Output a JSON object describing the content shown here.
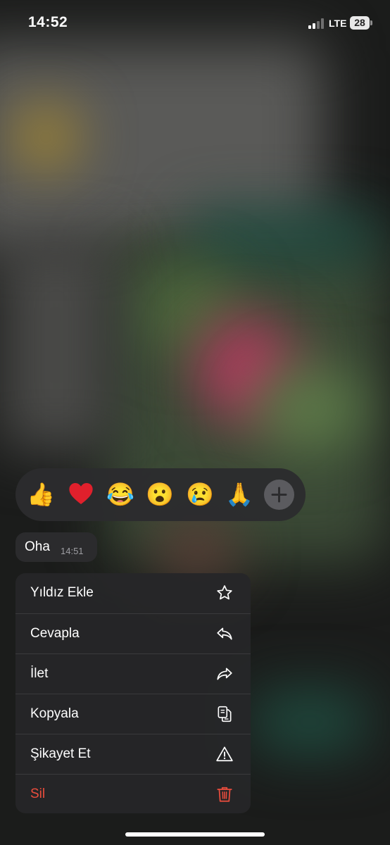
{
  "status_bar": {
    "time": "14:52",
    "network": "LTE",
    "battery": "28"
  },
  "reactions": {
    "emojis": [
      "👍",
      "❤️",
      "😂",
      "😮",
      "😢",
      "🙏"
    ],
    "more_icon": "plus-icon"
  },
  "message": {
    "text": "Oha",
    "time": "14:51"
  },
  "context_menu": {
    "items": [
      {
        "label": "Yıldız Ekle",
        "icon": "star-icon"
      },
      {
        "label": "Cevapla",
        "icon": "reply-icon"
      },
      {
        "label": "İlet",
        "icon": "forward-icon"
      },
      {
        "label": "Kopyala",
        "icon": "copy-icon"
      },
      {
        "label": "Şikayet Et",
        "icon": "warning-icon"
      },
      {
        "label": "Sil",
        "icon": "trash-icon",
        "color": "#eb4d3d"
      }
    ]
  },
  "colors": {
    "menu_background": "#262628",
    "danger": "#eb4d3d",
    "plus_button": "#5b5b5f"
  }
}
